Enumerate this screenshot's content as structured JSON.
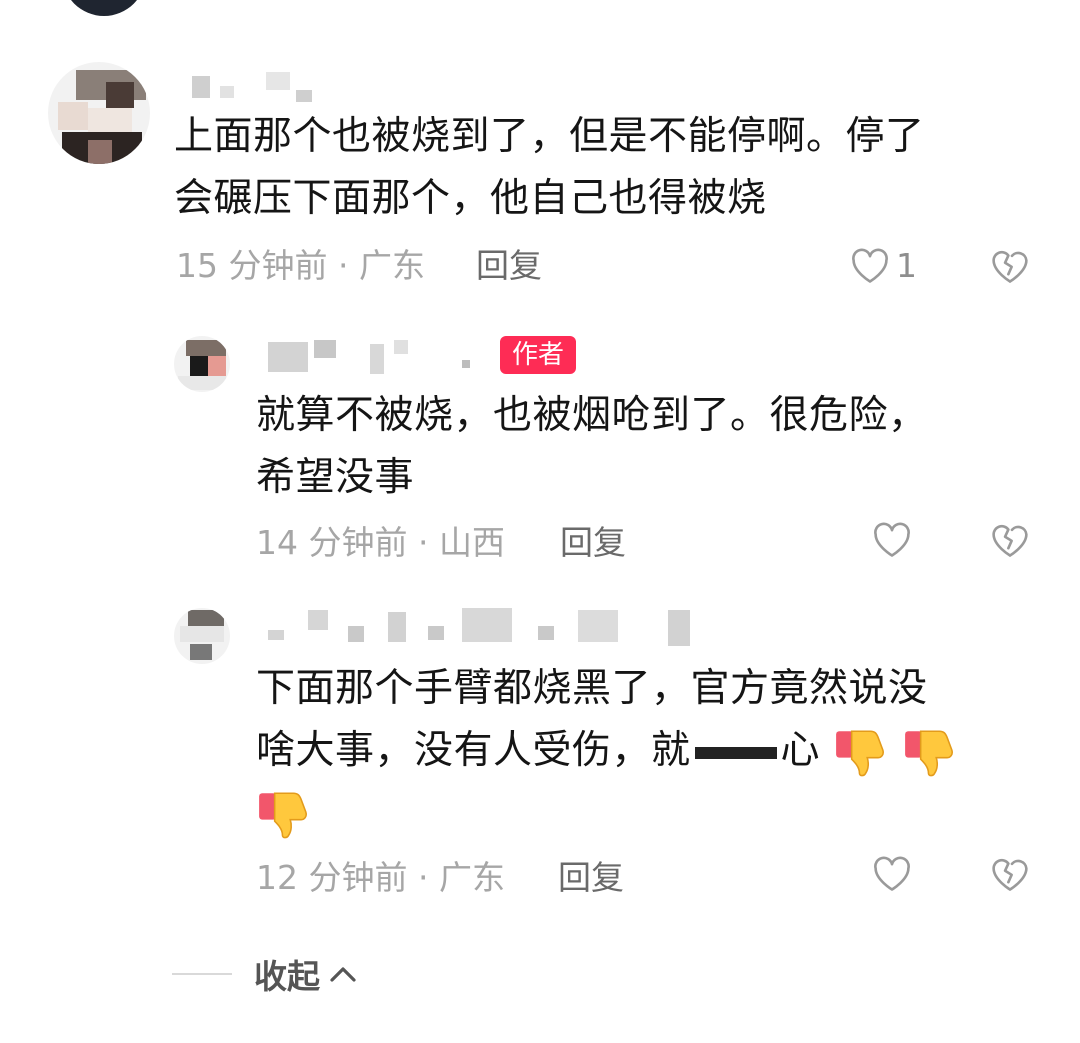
{
  "comments": [
    {
      "text_line1": "上面那个也被烧到了，但是不能停啊。停了",
      "text_line2": "会碾压下面那个，他自己也得被烧",
      "time_location": "15 分钟前 · 广东",
      "reply_label": "回复",
      "like_count": "1"
    },
    {
      "badge": "作者",
      "text_line1": "就算不被烧，也被烟呛到了。很危险，",
      "text_line2": "希望没事",
      "time_location": "14 分钟前 · 山西",
      "reply_label": "回复",
      "like_count": ""
    },
    {
      "text_line1": "下面那个手臂都烧黑了，官方竟然说没",
      "text_line2a": "啥大事，没有人受伤，就",
      "text_line2b": "心",
      "time_location": "12 分钟前 · 广东",
      "reply_label": "回复",
      "like_count": ""
    }
  ],
  "collapse_label": "收起",
  "icons": {
    "like": "heart-outline-icon",
    "dislike": "broken-heart-icon",
    "emoji": "thumbs-down-emoji",
    "collapse": "chevron-up-icon"
  },
  "colors": {
    "badge": "#fe2c55",
    "text": "#151515",
    "meta": "#a6a6a6"
  }
}
